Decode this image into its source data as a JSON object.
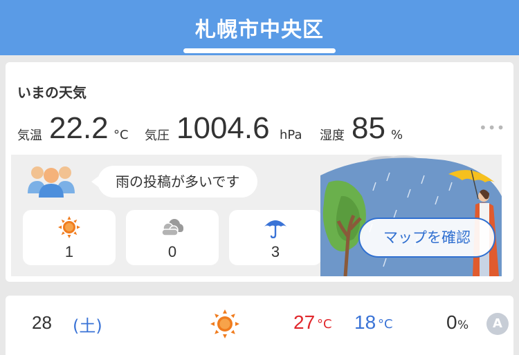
{
  "header": {
    "title": "札幌市中央区"
  },
  "current": {
    "section_title": "いまの天気",
    "temperature": {
      "label": "気温",
      "value": "22.2",
      "unit": "°C"
    },
    "pressure": {
      "label": "気圧",
      "value": "1004.6",
      "unit": "hPa"
    },
    "humidity": {
      "label": "湿度",
      "value": "85",
      "unit": "%"
    },
    "more_icon": "more-horizontal-icon"
  },
  "reports": {
    "message": "雨の投稿が多いです",
    "counts": [
      {
        "icon": "sun-icon",
        "value": "1"
      },
      {
        "icon": "cloud-icon",
        "value": "0"
      },
      {
        "icon": "umbrella-icon",
        "value": "3"
      }
    ],
    "map_button": "マップを確認"
  },
  "forecast": [
    {
      "day": "28",
      "weekday": "(土)",
      "weather_icon": "sun-icon",
      "high": "27",
      "high_unit": "°C",
      "low": "18",
      "low_unit": "°C",
      "precip": "0",
      "precip_unit": "%",
      "badge": "A"
    }
  ],
  "colors": {
    "header": "#5a9be6",
    "high_temp": "#e0262b",
    "low_temp": "#3a73d6",
    "sun": "#f07c1e",
    "umbrella": "#3a73d6",
    "accent_button": "#2f6fd0"
  }
}
